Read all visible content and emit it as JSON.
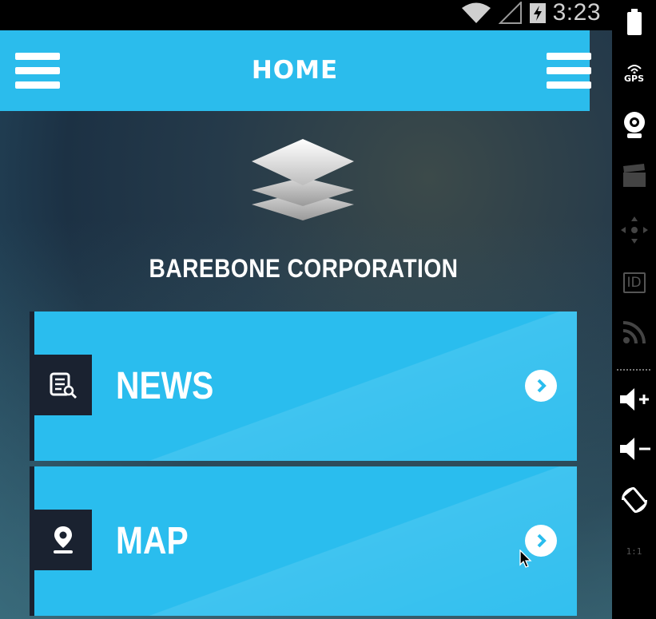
{
  "status_bar": {
    "time": "3:23"
  },
  "header": {
    "title": "HOME",
    "left_menu_icon": "hamburger-icon",
    "right_menu_icon": "hamburger-icon"
  },
  "brand": {
    "logo_icon": "layers-icon",
    "company_name": "BAREBONE CORPORATION"
  },
  "menu": [
    {
      "label": "NEWS",
      "icon": "news-icon",
      "action_icon": "chevron-right-icon"
    },
    {
      "label": "MAP",
      "icon": "map-pin-icon",
      "action_icon": "chevron-right-icon"
    }
  ],
  "emulator_toolbar": {
    "gps_label": "GPS",
    "id_label": "ID",
    "ratio_label": "1:1",
    "tools": [
      "battery-icon",
      "gps-icon",
      "camera-icon",
      "clapper-icon",
      "dpad-icon",
      "id-icon",
      "rss-icon",
      "volume-up-icon",
      "volume-down-icon",
      "rotate-icon",
      "scale-icon"
    ]
  },
  "colors": {
    "header": "#2bbcec",
    "card": "#2abdee",
    "icon_box": "#1a2230"
  }
}
